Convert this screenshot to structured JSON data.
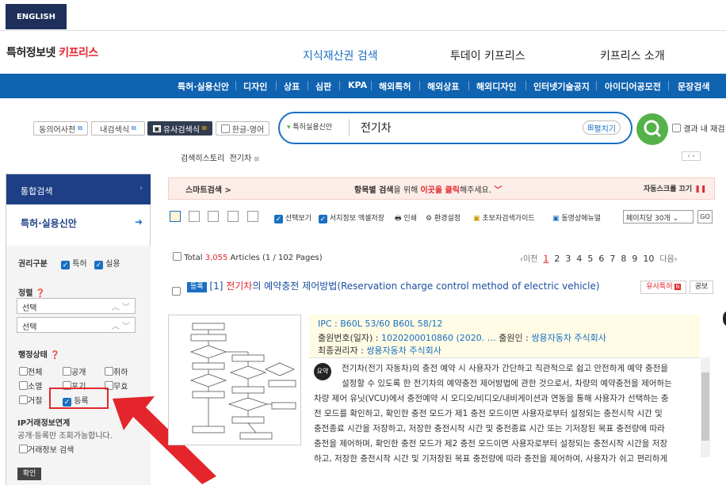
{
  "header": {
    "english_btn": "ENGLISH",
    "logo_dark": "특허정보넷 ",
    "logo_red": "키프리스",
    "nav": [
      "지식재산권 검색",
      "투데이 키프리스",
      "키프리스 소개"
    ]
  },
  "bluebar": [
    "특허·실용신안",
    "디자인",
    "상표",
    "심판",
    "KPA",
    "해외특허",
    "해외상표",
    "해외디자인",
    "인터넷기술공지",
    "아이디어공모전",
    "문장검색"
  ],
  "tools": {
    "synonym": "동의어사전",
    "my_expr": "내검색식",
    "similar": "유사검색식",
    "hangul": "한글-영어"
  },
  "search": {
    "category": "특허실용신안",
    "query": "전기차",
    "expand": "펼치기",
    "result_in": "결과 내 재검"
  },
  "history": {
    "label": "검색히스토리",
    "item": "전기차"
  },
  "sidebar": {
    "head": "통합검색",
    "patent": "특허·실용신안",
    "rights_label": "권리구분",
    "rights": [
      "특허",
      "실용"
    ],
    "sort_label": "정렬",
    "sort1": "선택",
    "sort2": "선택",
    "status_label": "행정상태",
    "statuses": [
      "전체",
      "공개",
      "취하",
      "소멸",
      "포기",
      "무효",
      "거절",
      "등록"
    ],
    "ipx_title": "IP거래정보연계",
    "ipx_desc": "공개·등록만 조회가능합니다.",
    "ipx_check": "거래정보 검색",
    "confirm": "확인"
  },
  "smart": {
    "left": "스마트검색 >",
    "mid1": "항목별 검색",
    "mid2": "을 위해 ",
    "mid3": "이곳을 클릭",
    "mid4": "해주세요.",
    "right": "자동스크롤 끄기"
  },
  "toolbar": {
    "selview": "선택보기",
    "save": "서지정보 엑셀저장",
    "print": "인쇄",
    "env": "환경설정",
    "guide": "초보자검색가이드",
    "video": "동영상메뉴얼",
    "perpage": "페이지당 30개",
    "go": "GO"
  },
  "results": {
    "total_pre": "Total ",
    "total_num": "3,055",
    "total_post": " Articles (1 / 102 Pages)",
    "prev": "‹이전",
    "pages": [
      "1",
      "2",
      "3",
      "4",
      "5",
      "6",
      "7",
      "8",
      "9",
      "10"
    ],
    "next": "다음›"
  },
  "item": {
    "badge": "등록",
    "num": "[1] ",
    "kw": "전기차",
    "title_rest": "의 예약충전 제어방법(Reservation charge control method of electric vehicle)",
    "sim_btn": "유사특허",
    "pub_btn": "공보",
    "ipc_label": "IPC : ",
    "ipc_val": "B60L 53/60    B60L 58/12",
    "appno_label": "출원번호(일자) : ",
    "appno_val": "1020200010860 (2020. … ",
    "applicant_label": "출원인 : ",
    "applicant_val": "쌍용자동차 주식회사",
    "owner_label": "최종권리자 : ",
    "owner_val": "쌍용자동차 주식회사",
    "summary_badge": "요약",
    "abstract": [
      "전기차(전기 자동차)의 충전 예약 시 사용자가 간단하고 직관적으로 쉽고 안전하게 예약 충전을",
      "설정할 수 있도록 한 전기차의 예약충전 제어방법에 관한 것으로서, 차량의 예약충전을 제어하는",
      "차량 제어 유닛(VCU)에서 충전예약 시 오디오/비디오/내비게이션과 연동을 통해 사용자가 선택하는 충",
      "전 모드를 확인하고, 확인한 충전 모드가 제1 충전 모드이면 사용자로부터 설정되는 충전시작 시간 및",
      "충전종료 시간을 저장하고, 저장한 충전시작 시간 및 충전종료 시간 또는 기저장된 목표 충전량에 따라",
      "충전을 제어하며, 확인한 충전 모드가 제2 충전 모드이면 사용자로부터 설정되는 충전시작 시간을 저장",
      "하고, 저장한 충전시작 시간 및 기저장된 목표 충전량에 따라 충전을 제어하여, 사용자가 쉬고 편리하게"
    ]
  },
  "colors": {
    "nav_blue": "#0f63b0",
    "accent_red": "#e4262c",
    "sidebar_head": "#1e3f86",
    "search_green": "#55b14a"
  }
}
